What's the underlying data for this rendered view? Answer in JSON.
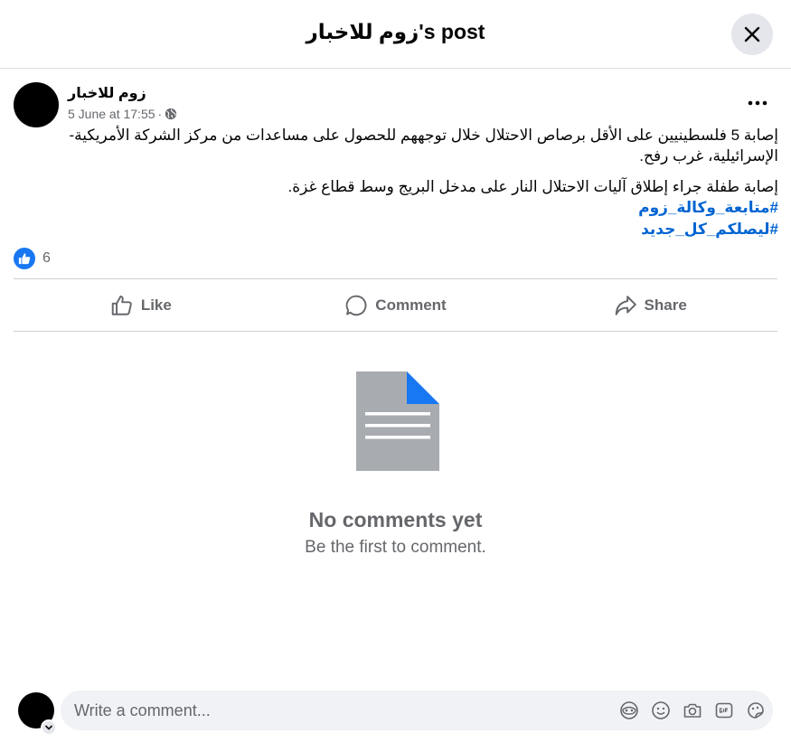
{
  "header": {
    "title": "زوم للاخبار's post"
  },
  "post": {
    "author": "زوم للاخبار",
    "timestamp": "5 June at 17:55",
    "separator": "·",
    "paragraph1": "إصابة 5 فلسطينيين على الأقل برصاص الاحتلال خلال توجههم للحصول على مساعدات من مركز الشركة الأمريكية- الإسرائيلية، غرب رفح.",
    "paragraph2": "إصابة طفلة جراء إطلاق آليات الاحتلال النار على مدخل البريج وسط قطاع غزة.",
    "hashtags": [
      "#متابعة_وكالة_زوم",
      "#ليصلكم_كل_جديد"
    ]
  },
  "reactions": {
    "count": "6"
  },
  "actions": {
    "like": "Like",
    "comment": "Comment",
    "share": "Share"
  },
  "empty_state": {
    "title": "No comments yet",
    "subtitle": "Be the first to comment."
  },
  "composer": {
    "placeholder": "Write a comment..."
  },
  "colors": {
    "accent": "#1877f2",
    "hashtag": "#0064d1",
    "muted": "#65676b"
  },
  "icons": [
    "close-icon",
    "more-icon",
    "globe-icon",
    "like-reaction-icon",
    "like-icon",
    "comment-icon",
    "share-icon",
    "document-icon",
    "chevron-down-icon",
    "avatar-icon",
    "emoji-icon",
    "camera-icon",
    "gif-icon",
    "sticker-icon"
  ]
}
